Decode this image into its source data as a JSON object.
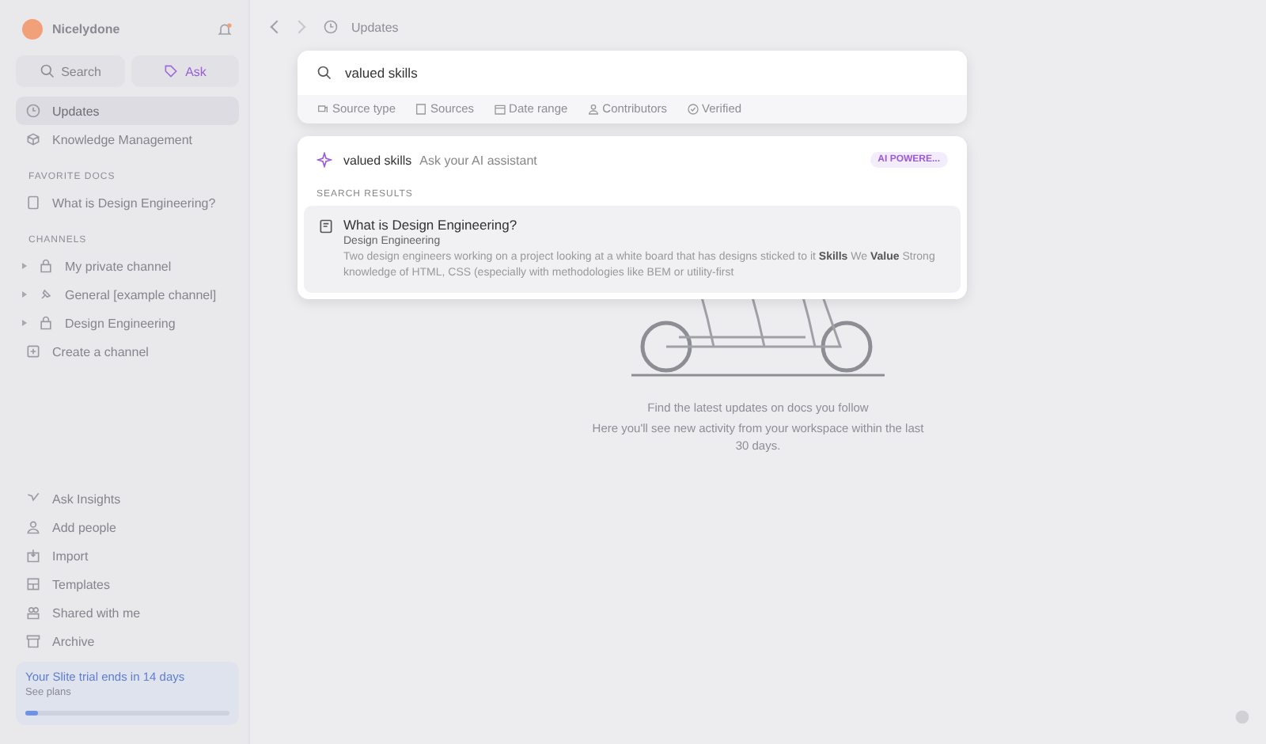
{
  "workspace": {
    "name": "Nicelydone"
  },
  "sidebar": {
    "top_buttons": [
      {
        "label": "Search",
        "kind": "search"
      },
      {
        "label": "Ask",
        "kind": "ask"
      }
    ],
    "nav": [
      {
        "label": "Updates",
        "selected": true
      },
      {
        "label": "Knowledge Management",
        "selected": false
      }
    ],
    "favorites_heading": "FAVORITE DOCS",
    "favorites": [
      {
        "label": "What is Design Engineering?"
      }
    ],
    "channels_heading": "CHANNELS",
    "channels": [
      {
        "label": "My private channel",
        "expanded": false
      },
      {
        "label": "General [example channel]",
        "expanded": false
      },
      {
        "label": "Design Engineering",
        "expanded": false
      }
    ],
    "create_channel": "Create a channel",
    "bottom": [
      {
        "label": "Ask Insights"
      },
      {
        "label": "Add people"
      },
      {
        "label": "Import"
      },
      {
        "label": "Templates"
      },
      {
        "label": "Shared with me"
      },
      {
        "label": "Archive"
      }
    ],
    "trial": {
      "title": "Your Slite trial ends in 14 days",
      "link": "See plans",
      "level": 0.06
    }
  },
  "header": {
    "title": "Updates"
  },
  "empty_state": {
    "title": "Find the latest updates on docs you follow",
    "body": "Here you'll see new activity from your workspace within the last 30 days."
  },
  "search": {
    "value": "valued skills",
    "filters": [
      {
        "label": "Source type"
      },
      {
        "label": "Sources"
      },
      {
        "label": "Date range"
      },
      {
        "label": "Contributors"
      },
      {
        "label": "Verified"
      }
    ],
    "ai_row": {
      "query": "valued skills",
      "hint": "Ask your AI assistant",
      "badge": "AI POWERE..."
    },
    "results_heading": "SEARCH RESULTS",
    "results": [
      {
        "title": "What is Design Engineering?",
        "channel": "Design Engineering",
        "snippet": "Two design engineers working on a project looking at a white board that has designs sticked to it **Skills** We **Value** Strong knowledge of HTML, CSS (especially with methodologies like BEM or utility-first",
        "selected": true
      }
    ]
  }
}
